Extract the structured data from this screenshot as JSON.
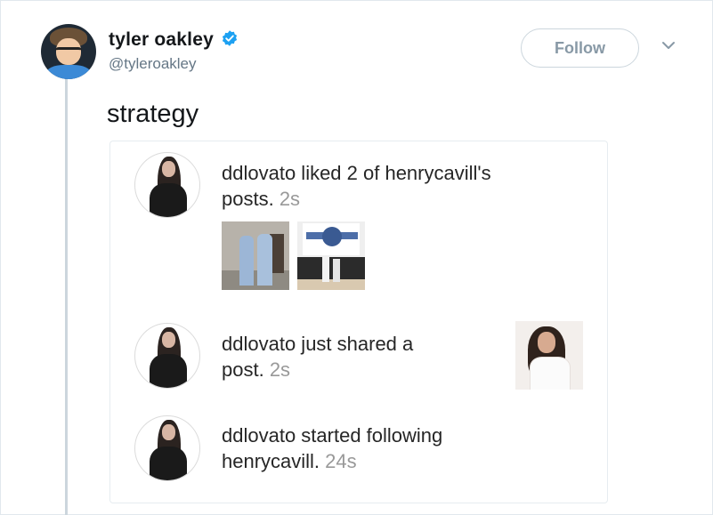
{
  "tweet": {
    "author": {
      "display_name": "tyler oakley",
      "handle": "@tyleroakley",
      "verified": true,
      "avatar_icon": "profile-photo"
    },
    "follow_label": "Follow",
    "more_icon": "chevron-down-icon",
    "text": "strategy"
  },
  "activity_card": {
    "items": [
      {
        "username": "ddlovato",
        "action": " liked 2 of henrycavill's",
        "action_line2": "posts. ",
        "time": "2s",
        "thumbnails": [
          "photo-two-men-gi",
          "photo-dojo-mat"
        ]
      },
      {
        "username": "ddlovato",
        "action": " just shared a",
        "action_line2": "post. ",
        "time": "2s",
        "thumbnails": [
          "photo-woman-white-dress"
        ]
      },
      {
        "username": "ddlovato",
        "action": " started following",
        "action_line2": "henrycavill. ",
        "time": "24s",
        "thumbnails": []
      }
    ]
  },
  "colors": {
    "text_primary": "#14171a",
    "text_secondary": "#657786",
    "verified_blue": "#1da1f2",
    "follow_text": "#8899a6",
    "instagram_timestamp": "#999999"
  }
}
